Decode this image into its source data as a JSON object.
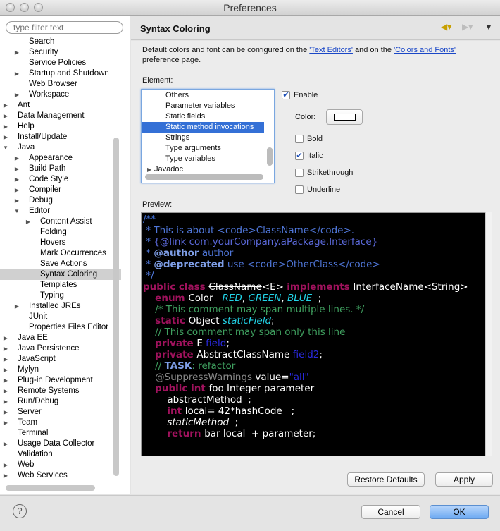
{
  "window": {
    "title": "Preferences"
  },
  "filter": {
    "placeholder": "type filter text"
  },
  "tree": [
    {
      "label": "Search",
      "depth": 2,
      "arrow": ""
    },
    {
      "label": "Security",
      "depth": 2,
      "arrow": "right"
    },
    {
      "label": "Service Policies",
      "depth": 2,
      "arrow": ""
    },
    {
      "label": "Startup and Shutdown",
      "depth": 2,
      "arrow": "right"
    },
    {
      "label": "Web Browser",
      "depth": 2,
      "arrow": ""
    },
    {
      "label": "Workspace",
      "depth": 2,
      "arrow": "right"
    },
    {
      "label": "Ant",
      "depth": 1,
      "arrow": "right"
    },
    {
      "label": "Data Management",
      "depth": 1,
      "arrow": "right"
    },
    {
      "label": "Help",
      "depth": 1,
      "arrow": "right"
    },
    {
      "label": "Install/Update",
      "depth": 1,
      "arrow": "right"
    },
    {
      "label": "Java",
      "depth": 1,
      "arrow": "down"
    },
    {
      "label": "Appearance",
      "depth": 2,
      "arrow": "right"
    },
    {
      "label": "Build Path",
      "depth": 2,
      "arrow": "right"
    },
    {
      "label": "Code Style",
      "depth": 2,
      "arrow": "right"
    },
    {
      "label": "Compiler",
      "depth": 2,
      "arrow": "right"
    },
    {
      "label": "Debug",
      "depth": 2,
      "arrow": "right"
    },
    {
      "label": "Editor",
      "depth": 2,
      "arrow": "down"
    },
    {
      "label": "Content Assist",
      "depth": 3,
      "arrow": "right"
    },
    {
      "label": "Folding",
      "depth": 3,
      "arrow": ""
    },
    {
      "label": "Hovers",
      "depth": 3,
      "arrow": ""
    },
    {
      "label": "Mark Occurrences",
      "depth": 3,
      "arrow": ""
    },
    {
      "label": "Save Actions",
      "depth": 3,
      "arrow": ""
    },
    {
      "label": "Syntax Coloring",
      "depth": 3,
      "arrow": "",
      "selected": true
    },
    {
      "label": "Templates",
      "depth": 3,
      "arrow": ""
    },
    {
      "label": "Typing",
      "depth": 3,
      "arrow": ""
    },
    {
      "label": "Installed JREs",
      "depth": 2,
      "arrow": "right"
    },
    {
      "label": "JUnit",
      "depth": 2,
      "arrow": ""
    },
    {
      "label": "Properties Files Editor",
      "depth": 2,
      "arrow": ""
    },
    {
      "label": "Java EE",
      "depth": 1,
      "arrow": "right"
    },
    {
      "label": "Java Persistence",
      "depth": 1,
      "arrow": "right"
    },
    {
      "label": "JavaScript",
      "depth": 1,
      "arrow": "right"
    },
    {
      "label": "Mylyn",
      "depth": 1,
      "arrow": "right"
    },
    {
      "label": "Plug-in Development",
      "depth": 1,
      "arrow": "right"
    },
    {
      "label": "Remote Systems",
      "depth": 1,
      "arrow": "right"
    },
    {
      "label": "Run/Debug",
      "depth": 1,
      "arrow": "right"
    },
    {
      "label": "Server",
      "depth": 1,
      "arrow": "right"
    },
    {
      "label": "Team",
      "depth": 1,
      "arrow": "right"
    },
    {
      "label": "Terminal",
      "depth": 1,
      "arrow": ""
    },
    {
      "label": "Usage Data Collector",
      "depth": 1,
      "arrow": "right"
    },
    {
      "label": "Validation",
      "depth": 1,
      "arrow": ""
    },
    {
      "label": "Web",
      "depth": 1,
      "arrow": "right"
    },
    {
      "label": "Web Services",
      "depth": 1,
      "arrow": "right"
    },
    {
      "label": "XML",
      "depth": 1,
      "arrow": "right"
    }
  ],
  "page": {
    "title": "Syntax Coloring",
    "desc_prefix": "Default colors and font can be configured on the ",
    "link1": "'Text Editors'",
    "desc_mid": " and on the ",
    "link2": "'Colors and Fonts'",
    "desc_suffix": " preference page.",
    "element_label": "Element:",
    "preview_label": "Preview:"
  },
  "elements": [
    {
      "label": "Others",
      "arrow": ""
    },
    {
      "label": "Parameter variables",
      "arrow": ""
    },
    {
      "label": "Static fields",
      "arrow": ""
    },
    {
      "label": "Static method invocations",
      "arrow": "",
      "selected": true
    },
    {
      "label": "Strings",
      "arrow": ""
    },
    {
      "label": "Type arguments",
      "arrow": ""
    },
    {
      "label": "Type variables",
      "arrow": ""
    },
    {
      "label": "Javadoc",
      "arrow": "right"
    }
  ],
  "options": {
    "enable": {
      "label": "Enable",
      "checked": true
    },
    "color_label": "Color:",
    "color_value": "#ffffff",
    "bold": {
      "label": "Bold",
      "checked": false
    },
    "italic": {
      "label": "Italic",
      "checked": true
    },
    "strikethrough": {
      "label": "Strikethrough",
      "checked": false
    },
    "underline": {
      "label": "Underline",
      "checked": false
    }
  },
  "preview_lines": [
    [
      {
        "t": "/**",
        "c": "#3f6fd8"
      }
    ],
    [
      {
        "t": " * This is about <code>ClassName</code>.",
        "c": "#4f76d8"
      }
    ],
    [
      {
        "t": " * ",
        "c": "#4f76d8"
      },
      {
        "t": "{@link com.yourCompany.aPackage.Interface}",
        "c": "#5a68d8"
      }
    ],
    [
      {
        "t": " * ",
        "c": "#4f76d8"
      },
      {
        "t": "@author",
        "c": "#7f9fe8",
        "b": true
      },
      {
        "t": " author",
        "c": "#4f76d8"
      }
    ],
    [
      {
        "t": " * ",
        "c": "#4f76d8"
      },
      {
        "t": "@deprecated",
        "c": "#7f9fe8",
        "b": true
      },
      {
        "t": " use <code>OtherClass</code>",
        "c": "#4f76d8"
      }
    ],
    [
      {
        "t": " */",
        "c": "#4f76d8"
      }
    ],
    [
      {
        "t": "public class ",
        "c": "#a0125d",
        "b": true
      },
      {
        "t": "ClassName",
        "c": "#ffffff",
        "s": true
      },
      {
        "t": "<E> ",
        "c": "#ffffff"
      },
      {
        "t": "implements ",
        "c": "#a0125d",
        "b": true
      },
      {
        "t": "InterfaceName<String>",
        "c": "#ffffff"
      }
    ],
    [
      {
        "t": "    ",
        "c": "#fff"
      },
      {
        "t": "enum ",
        "c": "#a0125d",
        "b": true
      },
      {
        "t": "Color   ",
        "c": "#ffffff"
      },
      {
        "t": "RED",
        "c": "#22d4e8",
        "i": true
      },
      {
        "t": ", ",
        "c": "#fff"
      },
      {
        "t": "GREEN",
        "c": "#22d4e8",
        "i": true
      },
      {
        "t": ", ",
        "c": "#fff"
      },
      {
        "t": "BLUE",
        "c": "#22d4e8",
        "i": true
      },
      {
        "t": "  ;",
        "c": "#fff"
      }
    ],
    [
      {
        "t": "    /* This comment may span multiple lines. */",
        "c": "#3f9f5f"
      }
    ],
    [
      {
        "t": "    ",
        "c": "#fff"
      },
      {
        "t": "static ",
        "c": "#a0125d",
        "b": true
      },
      {
        "t": "Object ",
        "c": "#fff"
      },
      {
        "t": "staticField",
        "c": "#22d4e8",
        "i": true
      },
      {
        "t": ";",
        "c": "#fff"
      }
    ],
    [
      {
        "t": "    // This comment may span only this line",
        "c": "#3f9f5f"
      }
    ],
    [
      {
        "t": "    ",
        "c": "#fff"
      },
      {
        "t": "private ",
        "c": "#a0125d",
        "b": true
      },
      {
        "t": "E ",
        "c": "#fff"
      },
      {
        "t": "field",
        "c": "#2a2ae0"
      },
      {
        "t": ";",
        "c": "#fff"
      }
    ],
    [
      {
        "t": "    ",
        "c": "#fff"
      },
      {
        "t": "private ",
        "c": "#a0125d",
        "b": true
      },
      {
        "t": "AbstractClassName ",
        "c": "#fff"
      },
      {
        "t": "field2",
        "c": "#2a2ae0"
      },
      {
        "t": ";",
        "c": "#fff"
      }
    ],
    [
      {
        "t": "    // ",
        "c": "#3f9f5f"
      },
      {
        "t": "TASK",
        "c": "#7f9fe8",
        "b": true
      },
      {
        "t": ": refactor",
        "c": "#3f9f5f"
      }
    ],
    [
      {
        "t": "    @SuppressWarnings ",
        "c": "#8a8a8a"
      },
      {
        "t": "value=",
        "c": "#fff"
      },
      {
        "t": "\"all\"",
        "c": "#2a2ae0"
      }
    ],
    [
      {
        "t": "    ",
        "c": "#fff"
      },
      {
        "t": "public int ",
        "c": "#a0125d",
        "b": true
      },
      {
        "t": "foo Integer parameter",
        "c": "#fff"
      }
    ],
    [
      {
        "t": "        abstractMethod  ;",
        "c": "#fff"
      }
    ],
    [
      {
        "t": "        ",
        "c": "#fff"
      },
      {
        "t": "int ",
        "c": "#a0125d",
        "b": true
      },
      {
        "t": "local= 42*hashCode   ;",
        "c": "#fff"
      }
    ],
    [
      {
        "t": "        ",
        "c": "#fff"
      },
      {
        "t": "staticMethod",
        "c": "#fff",
        "i": true
      },
      {
        "t": "  ;",
        "c": "#fff"
      }
    ],
    [
      {
        "t": "        ",
        "c": "#fff"
      },
      {
        "t": "return ",
        "c": "#a0125d",
        "b": true
      },
      {
        "t": "bar local  + parameter;",
        "c": "#fff"
      }
    ]
  ],
  "buttons": {
    "restore": "Restore Defaults",
    "apply": "Apply",
    "cancel": "Cancel",
    "ok": "OK",
    "help": "?"
  }
}
